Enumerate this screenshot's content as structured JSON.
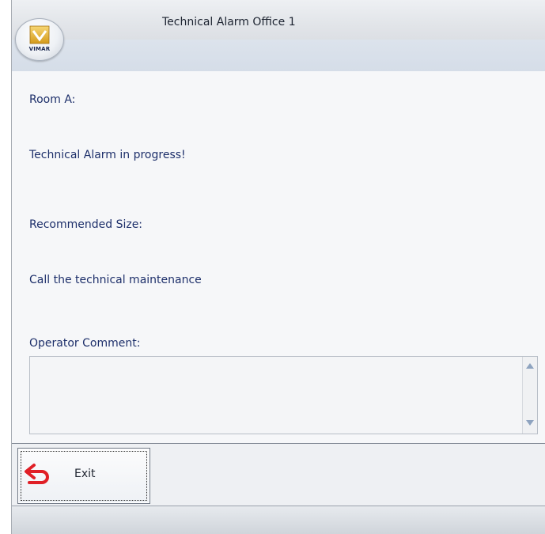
{
  "window": {
    "title": "Technical Alarm Office 1"
  },
  "app_button": {
    "brand": "VIMAR",
    "icon": "vimar-logo-icon"
  },
  "fields": {
    "room_label": "Room A:",
    "alarm_message": "Technical Alarm in progress!",
    "recommended_label": "Recommended Size:",
    "recommended_action": "Call the technical maintenance",
    "comment_label": "Operator Comment:"
  },
  "comment": {
    "value": ""
  },
  "toolbar": {
    "exit_label": "Exit",
    "exit_icon": "exit-arrow-icon"
  },
  "colors": {
    "label_text": "#1d2f6a",
    "exit_icon": "#e01f26"
  }
}
